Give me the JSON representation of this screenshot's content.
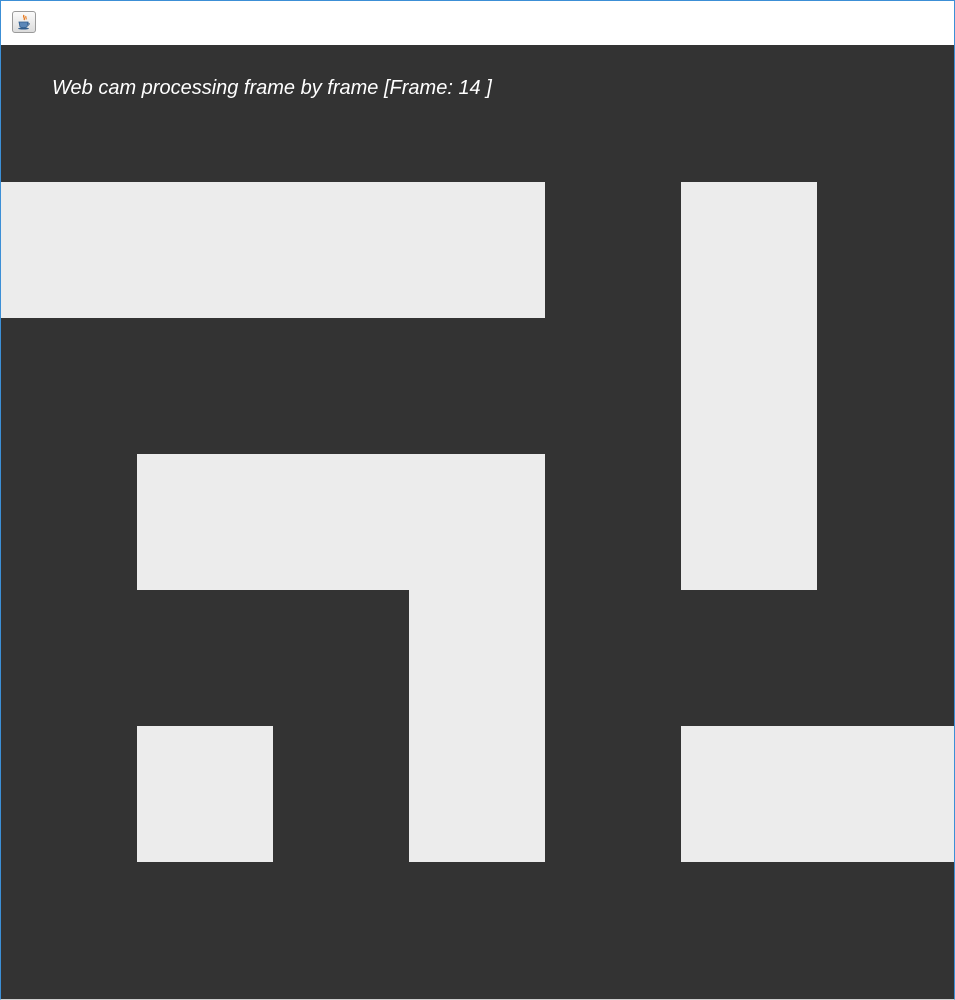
{
  "window": {
    "icon": "java-coffee-cup-icon"
  },
  "overlay": {
    "caption_prefix": "Web cam processing frame by frame [Frame:",
    "frame_number": "14",
    "caption_suffix": "]"
  },
  "colors": {
    "background": "#333333",
    "blocks": "#ececec",
    "text": "#ffffff"
  }
}
